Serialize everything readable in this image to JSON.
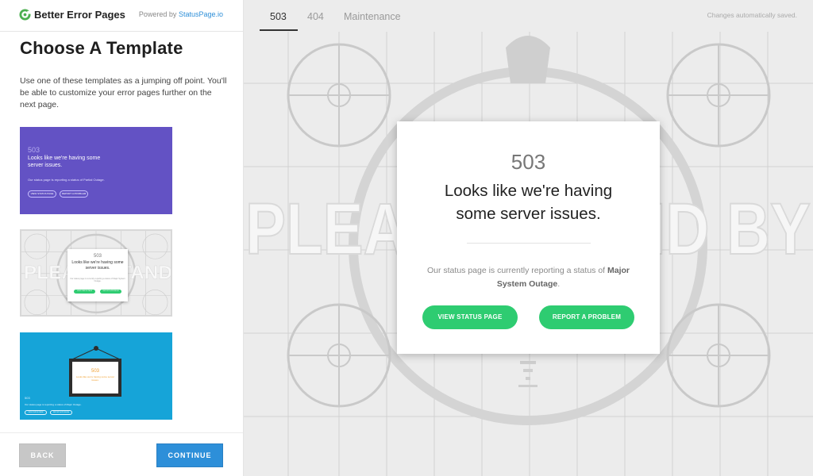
{
  "brand": {
    "name": "Better Error Pages",
    "powered_prefix": "Powered by",
    "powered_link": "StatusPage.io",
    "accent": "#4caf50"
  },
  "sidebar": {
    "title": "Choose A Template",
    "description": "Use one of these templates as a jumping off point. You'll be able to customize your error pages further on the next page.",
    "templates": [
      {
        "code": "503",
        "headline": "Looks like we're having some server issues.",
        "message": "Our status page is reporting a status of Partial Outage.",
        "buttons": [
          "VIEW STATUS PAGE",
          "REPORT A PROBLEM"
        ],
        "color": "#6352c4"
      },
      {
        "code": "503",
        "headline": "Looks like we're having some server issues.",
        "message": "Our status page is currently reporting a status of Major System Outage.",
        "banner": "PLEASE STAND BY",
        "buttons": [
          "VIEW STATUS PAGE",
          "REPORT A PROBLEM"
        ],
        "color": "#ececec"
      },
      {
        "code": "503",
        "headline": "Looks like we're having some server issues.",
        "message": "Our status page is reporting a status of Major Outage.",
        "buttons": [
          "VIEW STATUS PAGE",
          "REPORT A PROBLEM"
        ],
        "color": "#16a4d8"
      }
    ],
    "back_label": "BACK",
    "continue_label": "CONTINUE"
  },
  "preview": {
    "tabs": [
      "503",
      "404",
      "Maintenance"
    ],
    "active_tab": "503",
    "saved_status": "Changes automatically saved.",
    "banner": "PLEASE STAND BY",
    "card": {
      "code": "503",
      "headline": "Looks like we're having some server issues.",
      "message_prefix": "Our status page is currently reporting a status of",
      "status": "Major System Outage",
      "message_suffix": ".",
      "primary_button": "VIEW STATUS PAGE",
      "secondary_button": "REPORT A PROBLEM",
      "button_color": "#2ecc71"
    }
  }
}
